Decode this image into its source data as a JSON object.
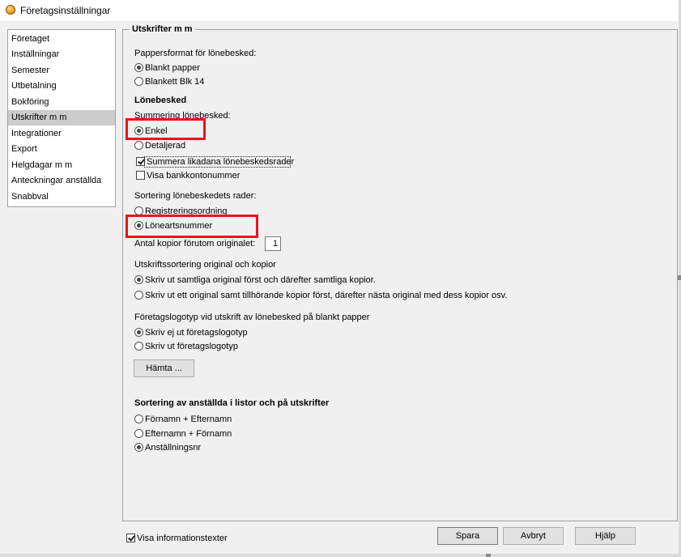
{
  "window": {
    "title": "Företagsinställningar"
  },
  "nav": {
    "items": [
      {
        "label": "Företaget"
      },
      {
        "label": "Inställningar"
      },
      {
        "label": "Semester"
      },
      {
        "label": "Utbetalning"
      },
      {
        "label": "Bokföring"
      },
      {
        "label": "Utskrifter m m",
        "selected": true
      },
      {
        "label": "Integrationer"
      },
      {
        "label": "Export"
      },
      {
        "label": "Helgdagar m m"
      },
      {
        "label": "Anteckningar anställda"
      },
      {
        "label": "Snabbval"
      }
    ]
  },
  "panel": {
    "title": "Utskrifter m m",
    "paper_format": {
      "label": "Pappersformat för lönebesked:",
      "options": [
        {
          "label": "Blankt papper",
          "checked": true
        },
        {
          "label": "Blankett Blk 14",
          "checked": false
        }
      ]
    },
    "lonebesked": {
      "heading": "Lönebesked",
      "summering_label": "Summering lönebesked:",
      "summering_options": [
        {
          "label": "Enkel",
          "checked": true
        },
        {
          "label": "Detaljerad",
          "checked": false
        }
      ],
      "sum_similar": {
        "label": "Summera likadana lönebeskedsrader",
        "checked": true
      },
      "show_bank": {
        "label": "Visa bankkontonummer",
        "checked": false
      },
      "sort_label": "Sortering lönebeskedets rader:",
      "sort_options": [
        {
          "label": "Registreringsordning",
          "checked": false
        },
        {
          "label": "Löneartsnummer",
          "checked": true
        }
      ],
      "copies_label": "Antal kopior förutom originalet:",
      "copies_value": "1"
    },
    "print_sort": {
      "label": "Utskriftssortering original och kopior",
      "options": [
        {
          "label": "Skriv ut samtliga original först och därefter samtliga kopior.",
          "checked": true
        },
        {
          "label": "Skriv ut ett original samt tillhörande kopior först, därefter nästa original med dess kopior osv.",
          "checked": false
        }
      ]
    },
    "logo": {
      "label": "Företagslogotyp vid utskrift av lönebesked på blankt papper",
      "options": [
        {
          "label": "Skriv ej ut företagslogotyp",
          "checked": true
        },
        {
          "label": "Skriv ut företagslogotyp",
          "checked": false
        }
      ],
      "fetch_button": "Hämta ..."
    },
    "employee_sort": {
      "heading": "Sortering av anställda i listor och på utskrifter",
      "options": [
        {
          "label": "Förnamn + Efternamn",
          "checked": false
        },
        {
          "label": "Efternamn + Förnamn",
          "checked": false
        },
        {
          "label": "Anställningsnr",
          "checked": true
        }
      ]
    }
  },
  "footer": {
    "show_info": {
      "label": "Visa informationstexter",
      "checked": true
    },
    "save_button": "Spara",
    "cancel_button": "Avbryt",
    "help_button": "Hjälp"
  },
  "colors": {
    "highlight": "#e8141c",
    "selected_nav": "#cccccc",
    "window_bg": "#f0f0f0"
  }
}
